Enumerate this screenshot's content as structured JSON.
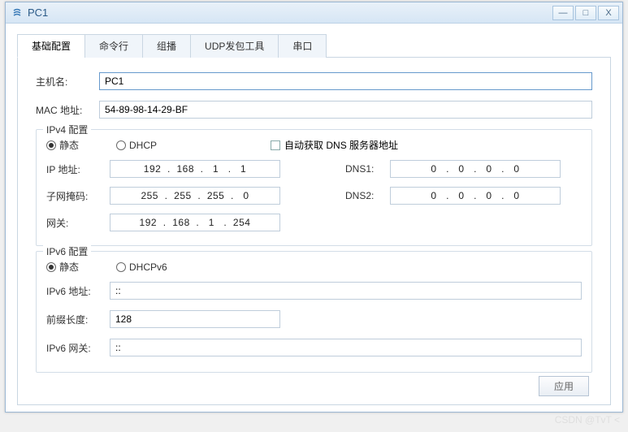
{
  "window": {
    "title": "PC1",
    "minimize": "—",
    "maximize": "□",
    "close": "X"
  },
  "tabs": {
    "basic": "基础配置",
    "cli": "命令行",
    "multicast": "组播",
    "udp": "UDP发包工具",
    "serial": "串口"
  },
  "host": {
    "hostname_label": "主机名:",
    "hostname_value": "PC1",
    "mac_label": "MAC 地址:",
    "mac_value": "54-89-98-14-29-BF"
  },
  "ipv4": {
    "legend": "IPv4 配置",
    "static_label": "静态",
    "dhcp_label": "DHCP",
    "auto_dns_label": "自动获取 DNS 服务器地址",
    "ip_label": "IP 地址:",
    "ip_value": "192  .  168  .   1   .   1",
    "mask_label": "子网掩码:",
    "mask_value": "255  .  255  .  255  .   0",
    "gw_label": "网关:",
    "gw_value": "192  .  168  .   1   .  254",
    "dns1_label": "DNS1:",
    "dns1_value": "0   .   0   .   0   .   0",
    "dns2_label": "DNS2:",
    "dns2_value": "0   .   0   .   0   .   0"
  },
  "ipv6": {
    "legend": "IPv6 配置",
    "static_label": "静态",
    "dhcp_label": "DHCPv6",
    "addr_label": "IPv6 地址:",
    "addr_value": "::",
    "prefix_label": "前缀长度:",
    "prefix_value": "128",
    "gw_label": "IPv6 网关:",
    "gw_value": "::"
  },
  "footer": {
    "apply": "应用"
  },
  "watermark": "CSDN @TvT <"
}
